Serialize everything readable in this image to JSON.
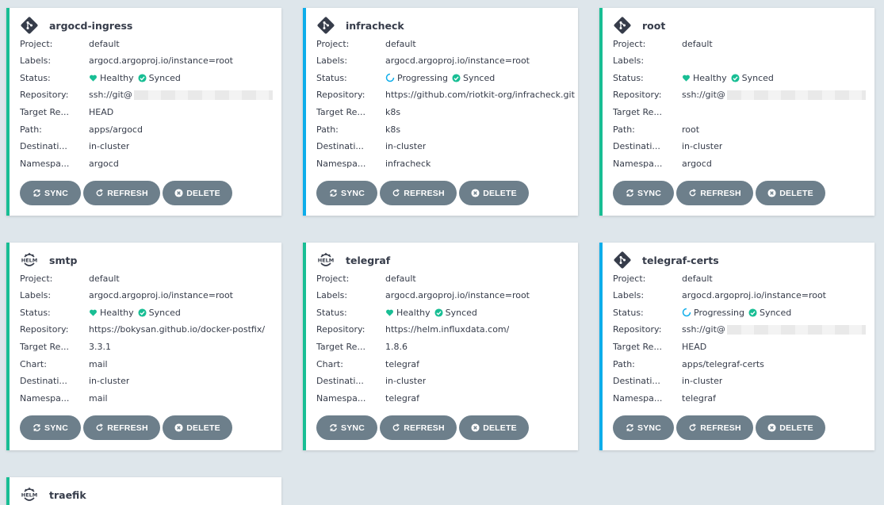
{
  "colors": {
    "healthy": "#18be94",
    "progressing": "#0dadea",
    "button": "#6d7f8b",
    "background": "#dee6eb"
  },
  "labels": {
    "project": "Project:",
    "labels": "Labels:",
    "status": "Status:",
    "repository": "Repository:",
    "target": "Target Re...",
    "path": "Path:",
    "chart": "Chart:",
    "destination": "Destinati...",
    "namespace": "Namespa..."
  },
  "buttons": {
    "sync": "SYNC",
    "refresh": "REFRESH",
    "delete": "DELETE"
  },
  "apps": [
    {
      "name": "argocd-ingress",
      "source_icon": "git-icon",
      "project": "default",
      "labels": "argocd.argoproj.io/instance=root",
      "health": "Healthy",
      "sync": "Synced",
      "repository": "ssh://git@",
      "target": "HEAD",
      "path_label": "Path:",
      "path": "apps/argocd",
      "destination": "in-cluster",
      "namespace": "argocd"
    },
    {
      "name": "infracheck",
      "source_icon": "git-icon",
      "project": "default",
      "labels": "argocd.argoproj.io/instance=root",
      "health": "Progressing",
      "sync": "Synced",
      "repository": "https://github.com/riotkit-org/infracheck.git",
      "target": "k8s",
      "path_label": "Path:",
      "path": "k8s",
      "destination": "in-cluster",
      "namespace": "infracheck"
    },
    {
      "name": "root",
      "source_icon": "git-icon",
      "project": "default",
      "labels": "",
      "health": "Healthy",
      "sync": "Synced",
      "repository": "ssh://git@",
      "target": "",
      "path_label": "Path:",
      "path": "root",
      "destination": "in-cluster",
      "namespace": "argocd"
    },
    {
      "name": "smtp",
      "source_icon": "helm-icon",
      "project": "default",
      "labels": "argocd.argoproj.io/instance=root",
      "health": "Healthy",
      "sync": "Synced",
      "repository": "https://bokysan.github.io/docker-postfix/",
      "target": "3.3.1",
      "path_label": "Chart:",
      "path": "mail",
      "destination": "in-cluster",
      "namespace": "mail"
    },
    {
      "name": "telegraf",
      "source_icon": "helm-icon",
      "project": "default",
      "labels": "argocd.argoproj.io/instance=root",
      "health": "Healthy",
      "sync": "Synced",
      "repository": "https://helm.influxdata.com/",
      "target": "1.8.6",
      "path_label": "Chart:",
      "path": "telegraf",
      "destination": "in-cluster",
      "namespace": "telegraf"
    },
    {
      "name": "telegraf-certs",
      "source_icon": "git-icon",
      "project": "default",
      "labels": "argocd.argoproj.io/instance=root",
      "health": "Progressing",
      "sync": "Synced",
      "repository": "ssh://git@",
      "target": "HEAD",
      "path_label": "Path:",
      "path": "apps/telegraf-certs",
      "destination": "in-cluster",
      "namespace": "telegraf"
    },
    {
      "name": "traefik",
      "source_icon": "helm-icon"
    }
  ]
}
